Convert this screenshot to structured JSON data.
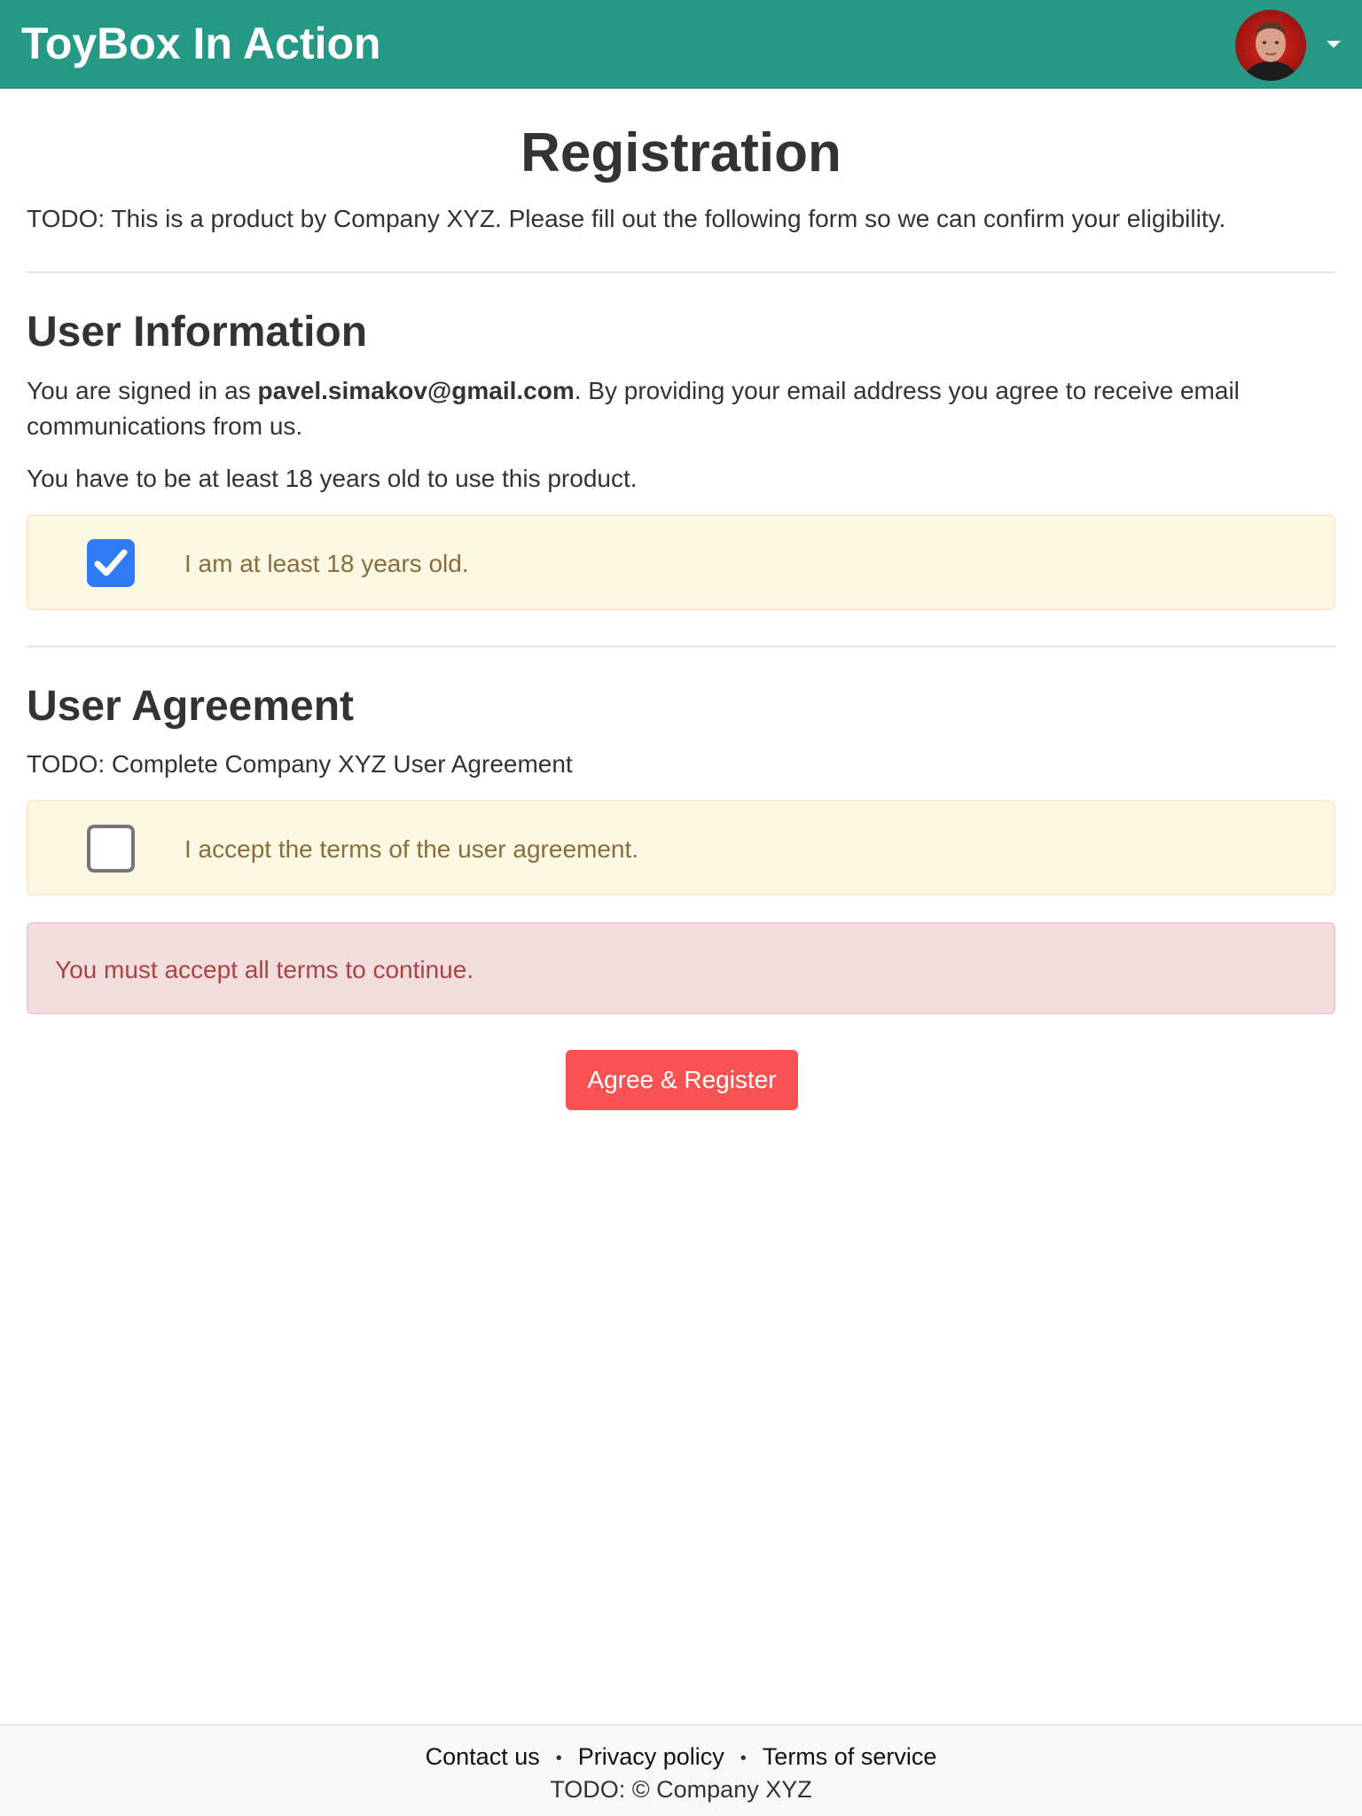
{
  "navbar": {
    "brand": "ToyBox In Action",
    "avatar_icon": "user-avatar",
    "menu_icon": "chevron-down-icon"
  },
  "page": {
    "title": "Registration",
    "intro": "TODO: This is a product by Company XYZ. Please fill out the following form so we can confirm your eligibility."
  },
  "user_info": {
    "heading": "User Information",
    "signed_in_prefix": "You are signed in as ",
    "email": "pavel.simakov@gmail.com",
    "signed_in_suffix": ". By providing your email address you agree to receive email communications from us.",
    "age_requirement": "You have to be at least 18 years old to use this product.",
    "age_checkbox_label": "I am at least 18 years old.",
    "age_checked": true
  },
  "agreement": {
    "heading": "User Agreement",
    "text": "TODO: Complete Company XYZ User Agreement",
    "terms_checkbox_label": "I accept the terms of the user agreement.",
    "terms_checked": false
  },
  "alert": {
    "message": "You must accept all terms to continue."
  },
  "submit_label": "Agree & Register",
  "footer": {
    "links": [
      "Contact us",
      "Privacy policy",
      "Terms of service"
    ],
    "separator": "•",
    "copyright": "TODO: © Company XYZ"
  },
  "colors": {
    "navbar": "#269886",
    "button": "#f85352",
    "checkbox_checked": "#2f7bf5",
    "warning_bg": "#fcf8e3",
    "danger_bg": "#f2dede"
  }
}
